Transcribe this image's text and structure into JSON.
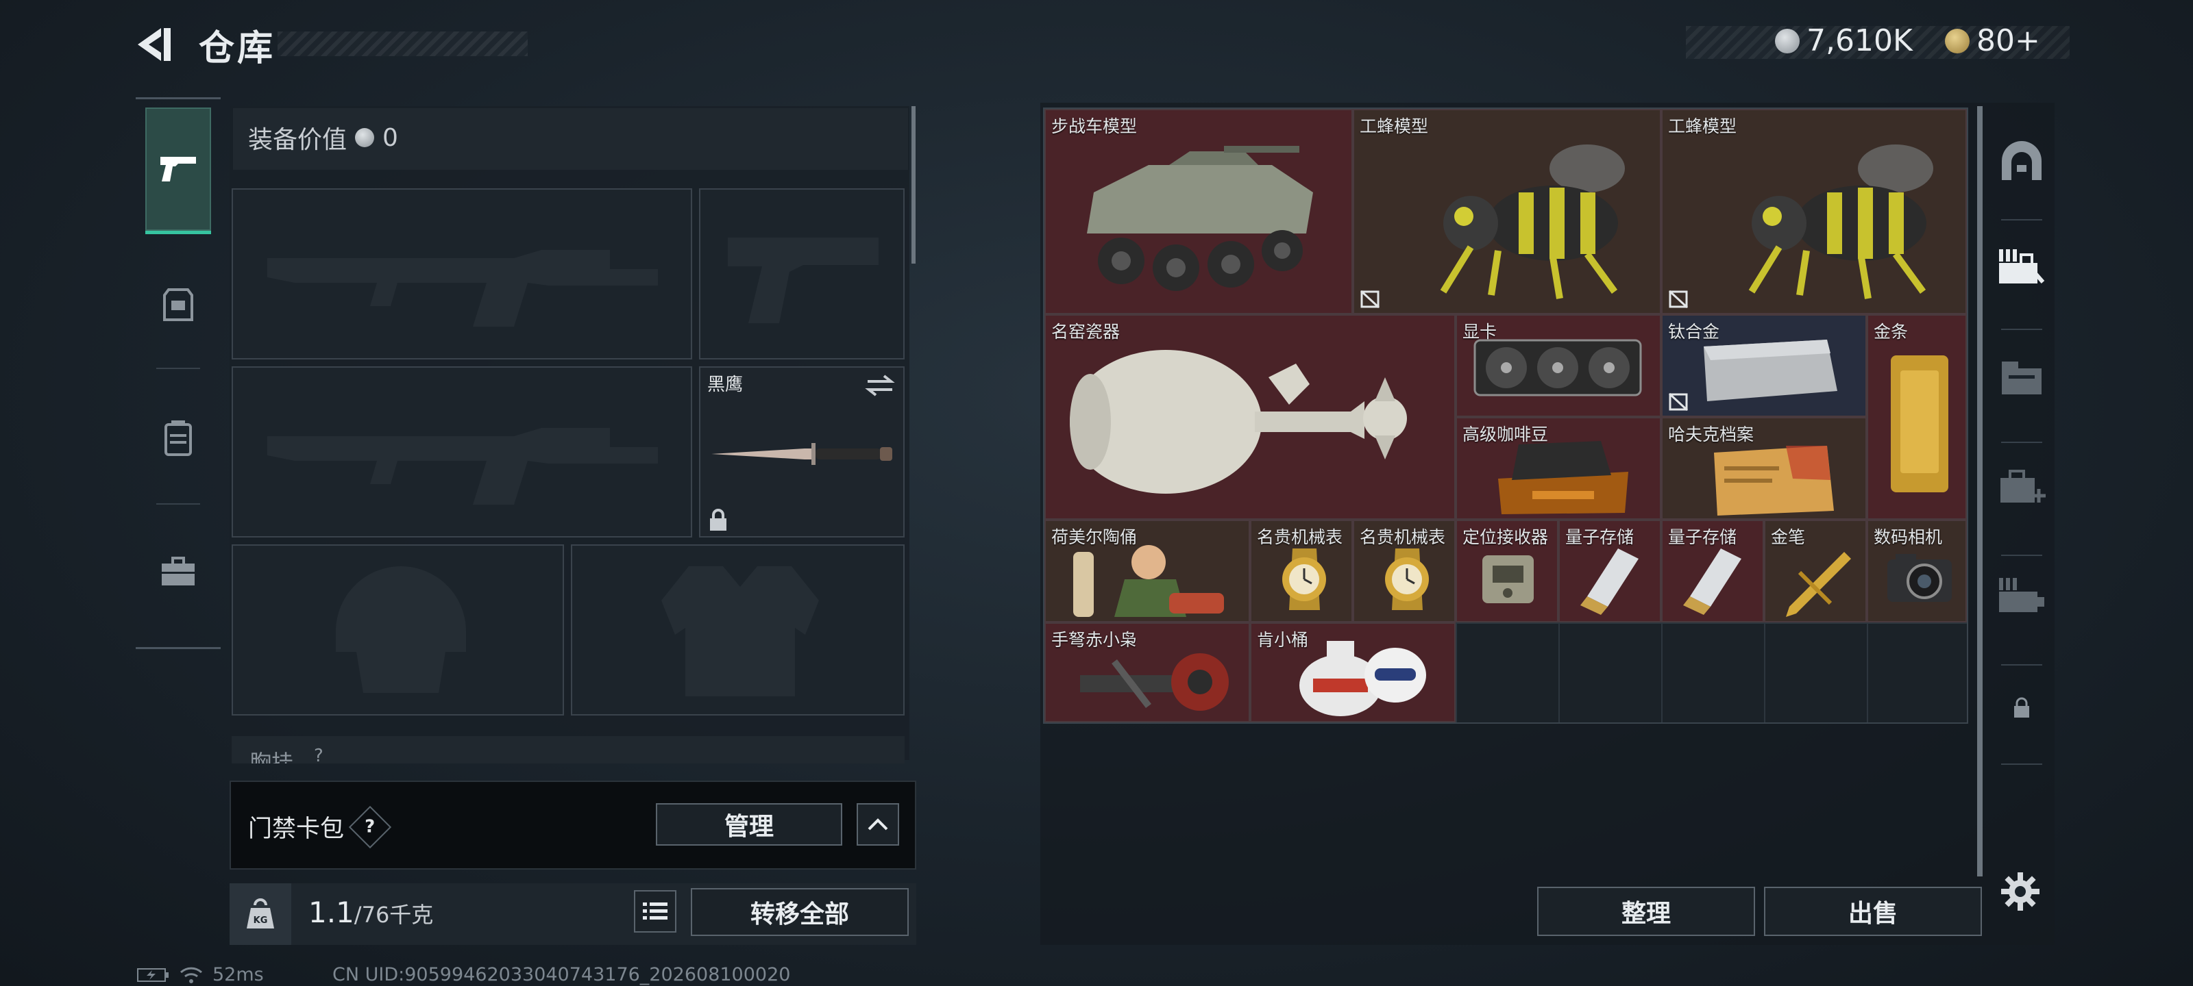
{
  "header": {
    "title": "仓库",
    "currency_silver": "7,610K",
    "currency_gold": "80+"
  },
  "equipment": {
    "value_label": "装备价值",
    "value": "0",
    "knife_name": "黑鹰",
    "chest_label": "胸挂",
    "chest_count": "?"
  },
  "card_pack": {
    "label": "门禁卡包",
    "help": "?",
    "manage_label": "管理"
  },
  "weight": {
    "current": "1.1",
    "max": "/76千克",
    "transfer_all_label": "转移全部"
  },
  "warehouse": {
    "items": [
      {
        "name": "步战车模型"
      },
      {
        "name": "工蜂模型"
      },
      {
        "name": "工蜂模型"
      },
      {
        "name": "名窑瓷器"
      },
      {
        "name": "显卡"
      },
      {
        "name": "钛合金"
      },
      {
        "name": "金条"
      },
      {
        "name": "高级咖啡豆"
      },
      {
        "name": "哈夫克档案"
      },
      {
        "name": "荷美尔陶俑"
      },
      {
        "name": "名贵机械表"
      },
      {
        "name": "名贵机械表"
      },
      {
        "name": "定位接收器"
      },
      {
        "name": "量子存储"
      },
      {
        "name": "量子存储"
      },
      {
        "name": "金笔"
      },
      {
        "name": "数码相机"
      },
      {
        "name": "手弩赤小枭"
      },
      {
        "name": "肯小桶"
      }
    ],
    "sort_label": "整理",
    "sell_label": "出售"
  },
  "footer": {
    "ping": "52ms",
    "uid": "CN UID:90599462033040743176_202608100020"
  },
  "colors": {
    "accent_green": "#36c4a0",
    "item_red": "#4a2328",
    "item_brown": "#3a2d27",
    "item_navy": "#272d3e"
  }
}
